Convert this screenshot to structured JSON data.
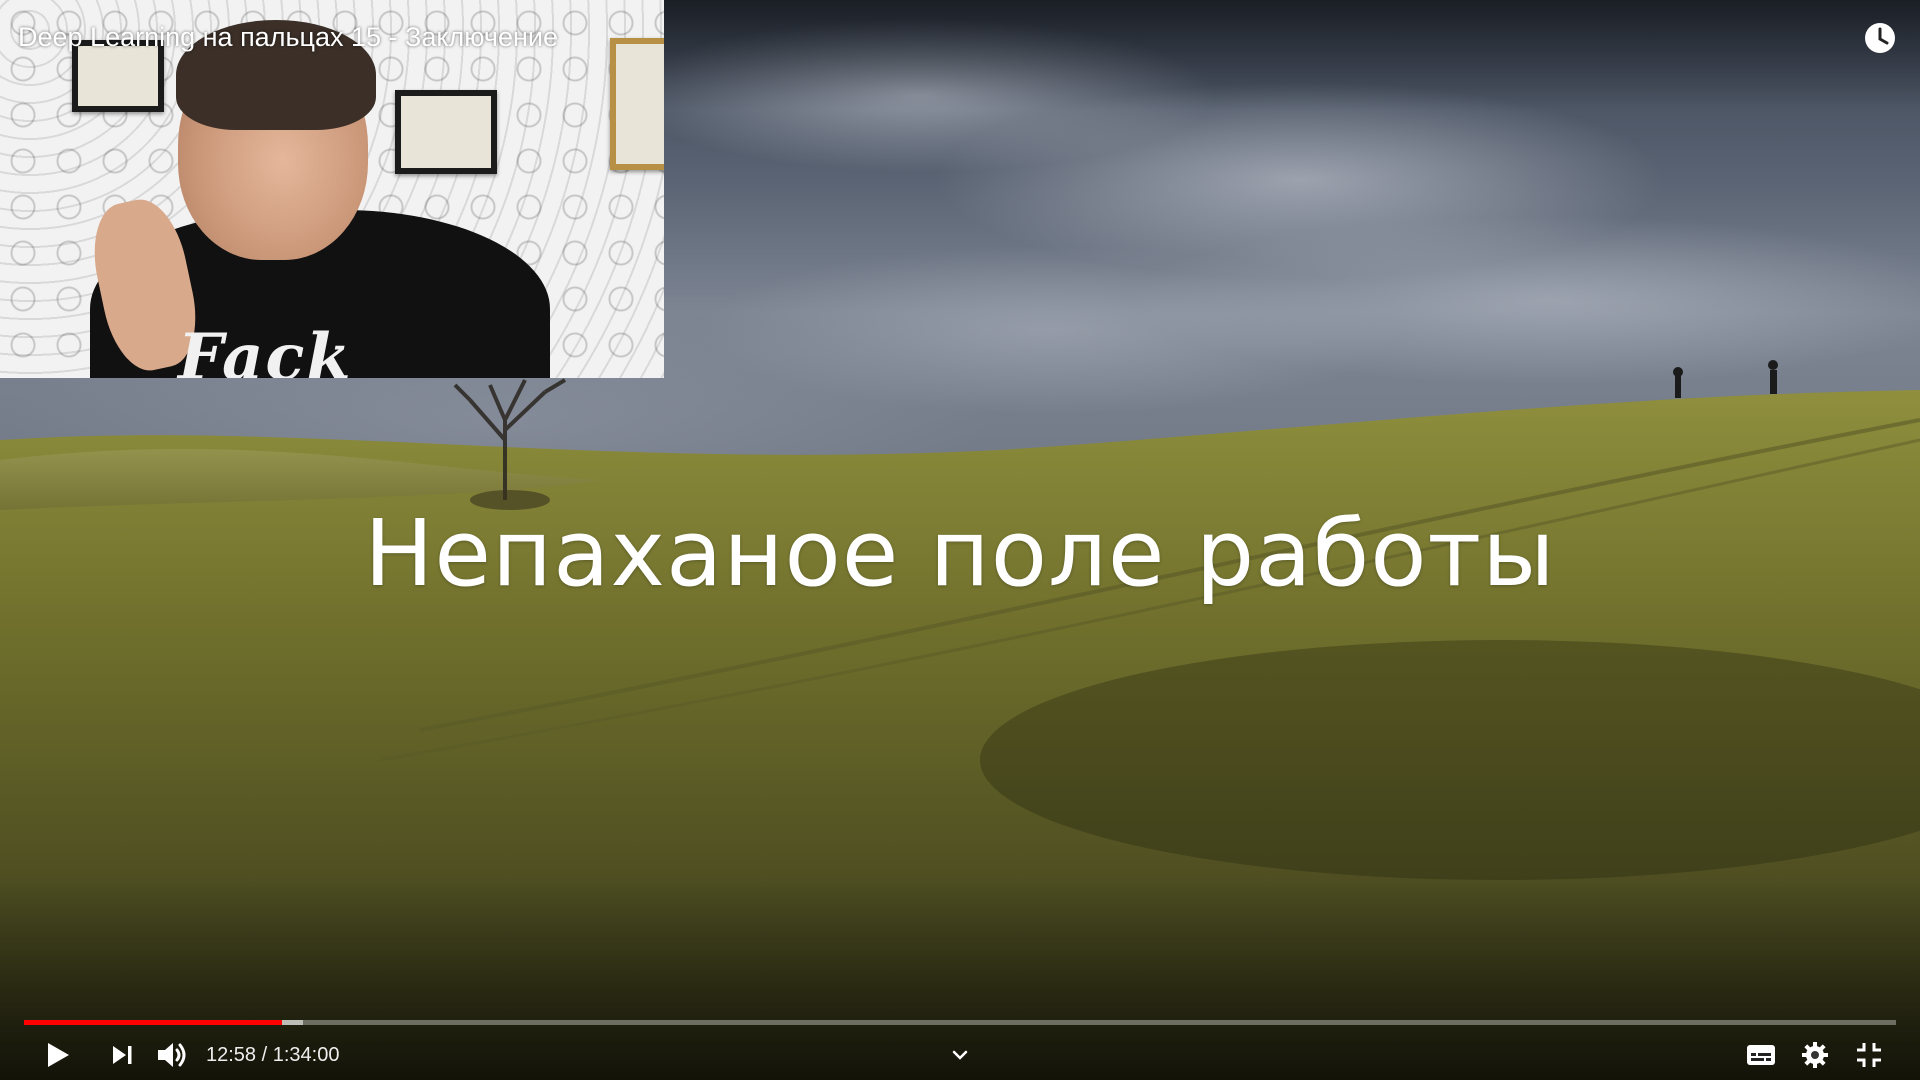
{
  "player": {
    "title": "Deep Learning на пальцах 15 - Заключение",
    "slide_caption": "Непаханое поле работы",
    "shirt_text": "Fack",
    "time": {
      "current": "12:58",
      "separator": " / ",
      "duration": "1:34:00"
    },
    "progress": {
      "played_fraction": 0.138,
      "buffered_fraction": 0.149
    },
    "colors": {
      "progress_played": "#ff0000",
      "icon": "#ffffff"
    },
    "icons": {
      "watch_later": "clock-icon",
      "play": "play-icon",
      "next": "next-icon",
      "volume": "volume-icon",
      "chapters": "chevron-down-icon",
      "subtitles": "subtitles-icon",
      "settings": "gear-icon",
      "exit_fullscreen": "exit-fullscreen-icon"
    }
  }
}
